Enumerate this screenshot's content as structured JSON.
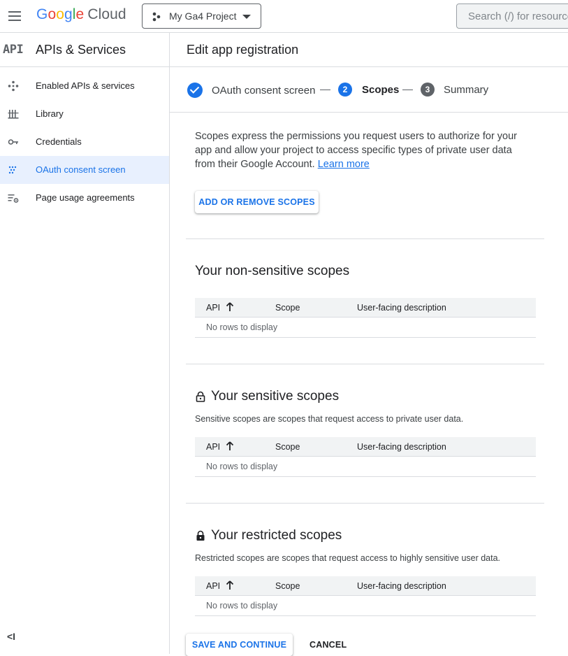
{
  "topbar": {
    "logo_google": "Google",
    "logo_cloud": "Cloud",
    "project_name": "My Ga4 Project",
    "search_placeholder": "Search (/) for resources"
  },
  "sidebar": {
    "api_mark": "API",
    "title": "APIs & Services",
    "items": [
      {
        "label": "Enabled APIs & services",
        "icon": "services-icon",
        "active": false
      },
      {
        "label": "Library",
        "icon": "library-icon",
        "active": false
      },
      {
        "label": "Credentials",
        "icon": "key-icon",
        "active": false
      },
      {
        "label": "OAuth consent screen",
        "icon": "consent-icon",
        "active": true
      },
      {
        "label": "Page usage agreements",
        "icon": "settings-list-icon",
        "active": false
      }
    ],
    "collapse_glyph": "<I"
  },
  "main": {
    "title": "Edit app registration",
    "stepper": {
      "step1": {
        "label": "OAuth consent screen"
      },
      "step2": {
        "number": "2",
        "label": "Scopes"
      },
      "step3": {
        "number": "3",
        "label": "Summary"
      }
    },
    "intro_text": "Scopes express the permissions you request users to authorize for your app and allow your project to access specific types of private user data from their Google Account.",
    "learn_more": "Learn more",
    "add_scopes_button": "ADD OR REMOVE SCOPES",
    "sections": {
      "non_sensitive": {
        "title": "Your non-sensitive scopes",
        "col_api": "API",
        "col_scope": "Scope",
        "col_desc": "User-facing description",
        "empty": "No rows to display"
      },
      "sensitive": {
        "title": "Your sensitive scopes",
        "description": "Sensitive scopes are scopes that request access to private user data.",
        "col_api": "API",
        "col_scope": "Scope",
        "col_desc": "User-facing description",
        "empty": "No rows to display"
      },
      "restricted": {
        "title": "Your restricted scopes",
        "description": "Restricted scopes are scopes that request access to highly sensitive user data.",
        "col_api": "API",
        "col_scope": "Scope",
        "col_desc": "User-facing description",
        "empty": "No rows to display"
      }
    },
    "save_button": "SAVE AND CONTINUE",
    "cancel_button": "CANCEL"
  },
  "colors": {
    "accent": "#1a73e8",
    "active_bg": "#e8f0fe",
    "divider": "#dadce0"
  }
}
